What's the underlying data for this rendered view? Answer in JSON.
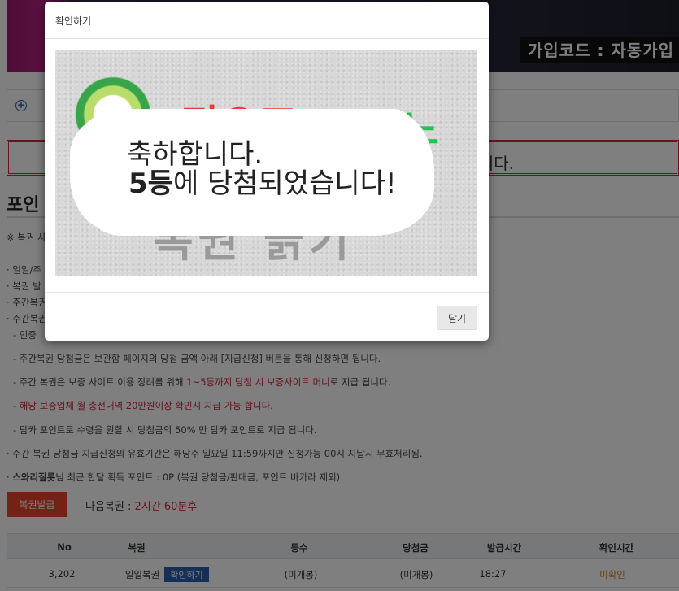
{
  "banner": {
    "code_text": "가입코드 : 자동가입"
  },
  "alert": {
    "text_tail": "니다."
  },
  "page": {
    "title": "포인"
  },
  "notes": {
    "n1": "※ 복권 사",
    "n2": "· 일일/주",
    "n3": "· 복권 발",
    "n4": "· 주간복권",
    "n5": "· 주간복권",
    "n6": "- 인증",
    "n7": "- 주간복권 당첨금은 보관함 페이지의 당첨 금액 아래 [지급신청] 버튼을 통해 신청하면 됩니다.",
    "n8_pre": "- 주간 복권은 보증 사이트 이용 장려를 위해 ",
    "n8_hl": "1~5등까지 당첨 시 보증사이트 머니",
    "n8_post": "로 지급 됩니다.",
    "n9": "- 해당 보증업체 월 충전내역 20만원이상 확인시 지급 가능 합니다.",
    "n10": "- 담카 포인트로 수령을 원할 시 당첨금의 50% 만 담카 포인트로 지급 됩니다.",
    "n11": "· 주간 복권 당첨금 지급신청의 유효기간은 해당주 일요일 11:59까지만 신청가능 00시 지날시 무효처리됨.",
    "n12_user": "스와리질롯",
    "n12_rest": "님 최근 한달 획득 포인트 : 0P (복권 당첨금/판매금, 포인트 바카라 제외)"
  },
  "actions": {
    "issue_label": "복권발급",
    "next_label": "다음복권 : ",
    "next_value": "2시간 60분후"
  },
  "table": {
    "headers": [
      "No",
      "복권",
      "등수",
      "당첨금",
      "발급시간",
      "확인시간"
    ],
    "row": {
      "no": "3,202",
      "type": "일일복권",
      "check_btn": "확인하기",
      "rank": "(미개봉)",
      "prize": "(미개봉)",
      "issued": "18:27",
      "status": "미확인"
    }
  },
  "modal": {
    "title": "확인하기",
    "logo_red": "펀오즈",
    "logo_green": "카지노",
    "logo_sub": "복권 긁기",
    "line1": "축하합니다.",
    "line2_bold": "5등",
    "line2_rest": "에 당첨되었습니다!",
    "close_label": "닫기"
  },
  "colors": {
    "accent_red": "#e8442c",
    "blue": "#2b5fb3",
    "overlay": "rgba(0,0,0,0.5)"
  }
}
